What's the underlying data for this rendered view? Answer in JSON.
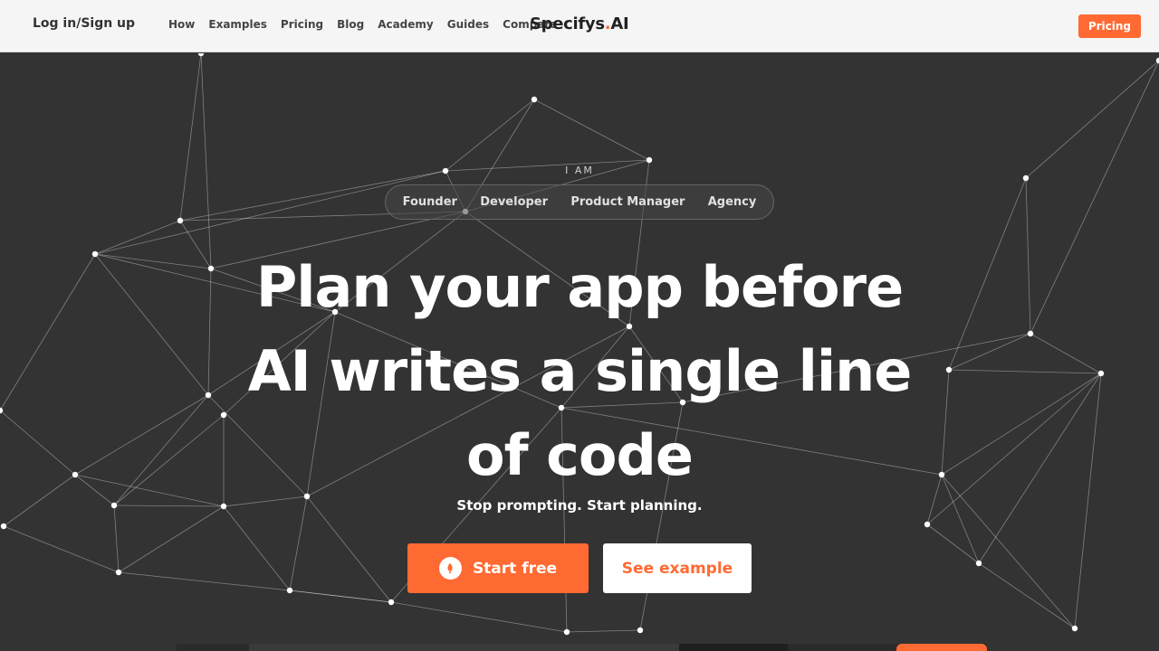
{
  "header": {
    "login_label": "Log in/Sign up",
    "nav": [
      "How",
      "Examples",
      "Pricing",
      "Blog",
      "Academy",
      "Guides",
      "Compare"
    ],
    "brand_main": "Specifys",
    "brand_dot": ".",
    "brand_suffix": "AI",
    "pricing_button": "Pricing"
  },
  "hero": {
    "iam_label": "I AM",
    "roles": [
      "Founder",
      "Developer",
      "Product Manager",
      "Agency"
    ],
    "headline_lines": [
      "Plan your app before",
      "AI writes a single line",
      "of code"
    ],
    "subheadline": "Stop prompting. Start planning.",
    "start_button": "Start free",
    "example_button": "See example"
  },
  "colors": {
    "accent": "#ff6a33",
    "hero_background": "#333333",
    "header_background": "#f5f5f5"
  },
  "icons": {
    "start_button_icon": "rocket-icon"
  }
}
